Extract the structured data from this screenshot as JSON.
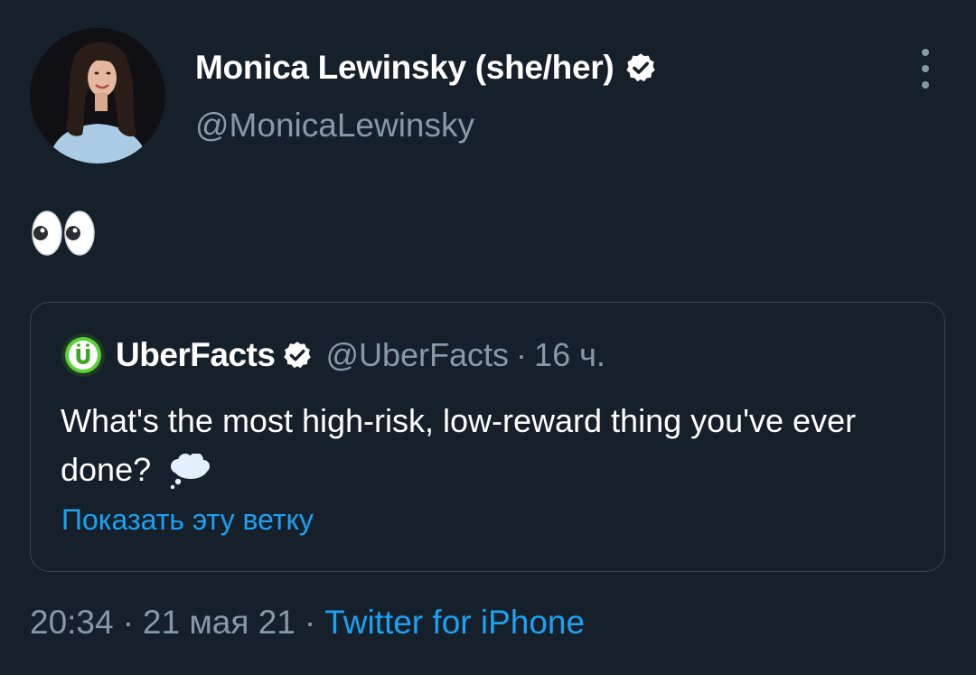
{
  "author": {
    "display_name": "Monica Lewinsky (she/her)",
    "handle": "@MonicaLewinsky",
    "verified_icon": "verified-badge-icon",
    "avatar": "profile-photo"
  },
  "more_icon": "more-vertical-icon",
  "tweet": {
    "body_emoji": "eyes-emoji"
  },
  "quoted_tweet": {
    "display_name": "UberFacts",
    "handle": "@UberFacts",
    "separator": "·",
    "time": "16 ч.",
    "avatar_icon": "uberfacts-logo-icon",
    "text": "What's the most high-risk, low-reward thing you've ever done?",
    "emoji": "thought-balloon-emoji",
    "show_thread": "Показать эту ветку"
  },
  "meta": {
    "time": "20:34",
    "separator": "·",
    "date": "21 мая 21",
    "source": "Twitter for iPhone"
  },
  "colors": {
    "background": "#15202b",
    "primary_text": "#ffffff",
    "secondary_text": "#8899a6",
    "link": "#1da1f2",
    "border": "#38444d",
    "uberfacts_green": "#5cd13a"
  }
}
